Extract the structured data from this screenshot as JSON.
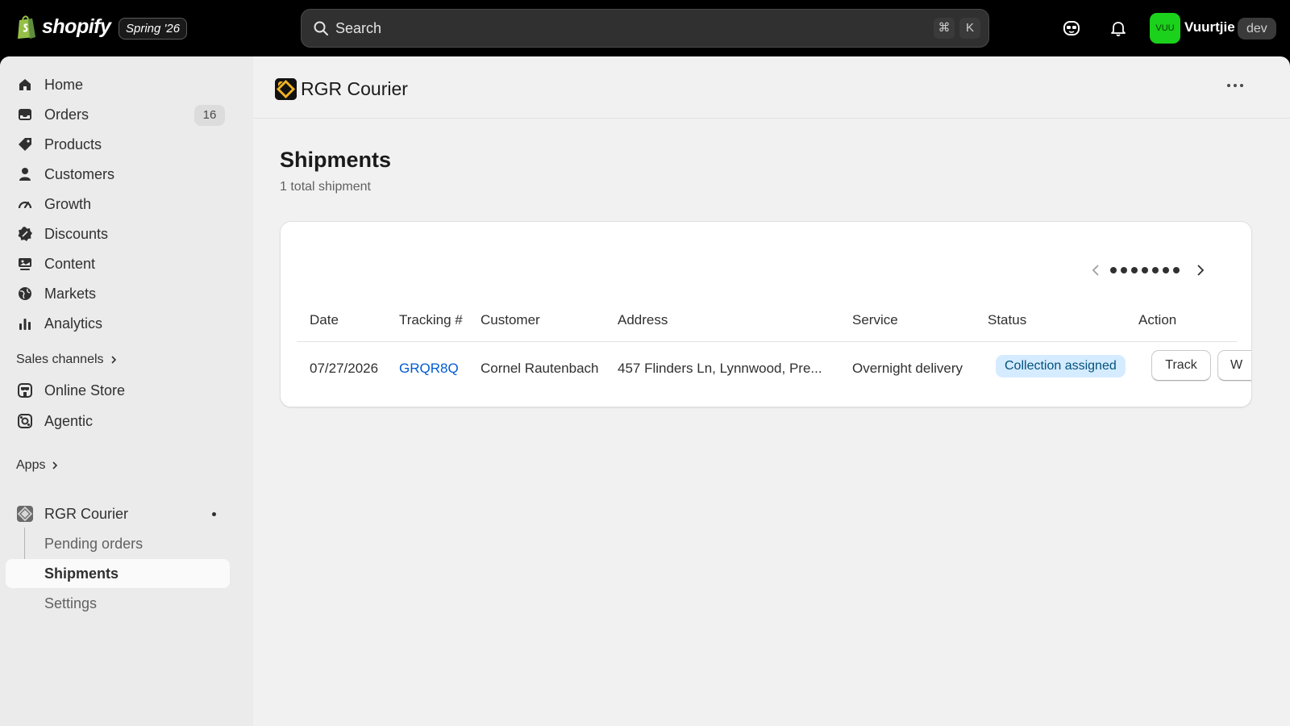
{
  "topbar": {
    "brand": "shopify",
    "release_badge": "Spring '26",
    "search_placeholder": "Search",
    "shortcut_cmd": "⌘",
    "shortcut_key": "K",
    "avatar_initials": "VUU",
    "user_name": "Vuurtjie",
    "env_badge": "dev",
    "icons": [
      "shopify-bag-icon",
      "search-icon",
      "sidekick-icon",
      "bell-icon"
    ]
  },
  "sidebar": {
    "items": [
      {
        "label": "Home",
        "icon": "home-icon"
      },
      {
        "label": "Orders",
        "icon": "orders-icon",
        "count": "16"
      },
      {
        "label": "Products",
        "icon": "tag-icon"
      },
      {
        "label": "Customers",
        "icon": "person-icon"
      },
      {
        "label": "Growth",
        "icon": "gauge-icon"
      },
      {
        "label": "Discounts",
        "icon": "discount-icon"
      },
      {
        "label": "Content",
        "icon": "content-icon"
      },
      {
        "label": "Markets",
        "icon": "globe-icon"
      },
      {
        "label": "Analytics",
        "icon": "bar-chart-icon"
      }
    ],
    "sales_channels_label": "Sales channels",
    "channels": [
      {
        "label": "Online Store",
        "icon": "store-icon"
      },
      {
        "label": "Agentic",
        "icon": "agentic-icon"
      }
    ],
    "apps_label": "Apps",
    "app": {
      "label": "RGR Courier",
      "sub_items": [
        {
          "label": "Pending orders",
          "active": false
        },
        {
          "label": "Shipments",
          "active": true
        },
        {
          "label": "Settings",
          "active": false
        }
      ]
    }
  },
  "main": {
    "app_title": "RGR Courier",
    "page_title": "Shipments",
    "page_subtitle": "1 total shipment",
    "pagination_pages": 7,
    "table": {
      "headers": [
        "Date",
        "Tracking #",
        "Customer",
        "Address",
        "Service",
        "Status",
        "Action"
      ],
      "rows": [
        {
          "date": "07/27/2026",
          "tracking": "GRQR8Q",
          "customer": "Cornel Rautenbach",
          "address": "457 Flinders Ln, Lynnwood, Pre...",
          "service": "Overnight delivery",
          "status": "Collection assigned",
          "actions": [
            "Track",
            "W"
          ]
        }
      ]
    }
  },
  "colors": {
    "topbar_bg": "#000000",
    "sidebar_bg": "#ebebeb",
    "content_bg": "#f1f1f1",
    "avatar_bg": "#1bd11b",
    "link": "#005bd3",
    "status_badge_bg": "#d5ebff",
    "status_badge_text": "#00527c"
  }
}
